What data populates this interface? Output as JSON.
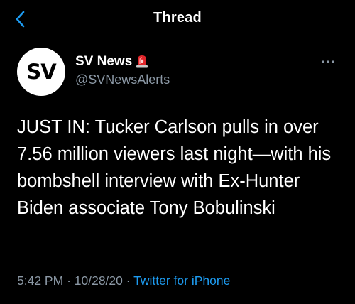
{
  "header": {
    "title": "Thread",
    "back_icon": "chevron-left-icon",
    "accent_color": "#1d9bf0"
  },
  "tweet": {
    "avatar_text": "SV",
    "display_name": "SV News",
    "name_badge_icon": "siren-emoji-icon",
    "handle": "@SVNewsAlerts",
    "more_icon": "ellipsis-icon",
    "text": "JUST IN: Tucker Carlson pulls in over 7.56 million viewers last night—with his bombshell interview with Ex-Hunter Biden associate Tony Bobulinski",
    "time": "5:42 PM",
    "separator": "·",
    "date": "10/28/20",
    "source": "Twitter for iPhone"
  },
  "colors": {
    "background": "#000000",
    "text": "#ffffff",
    "secondary_text": "#8b98a5",
    "link": "#1d9bf0"
  }
}
